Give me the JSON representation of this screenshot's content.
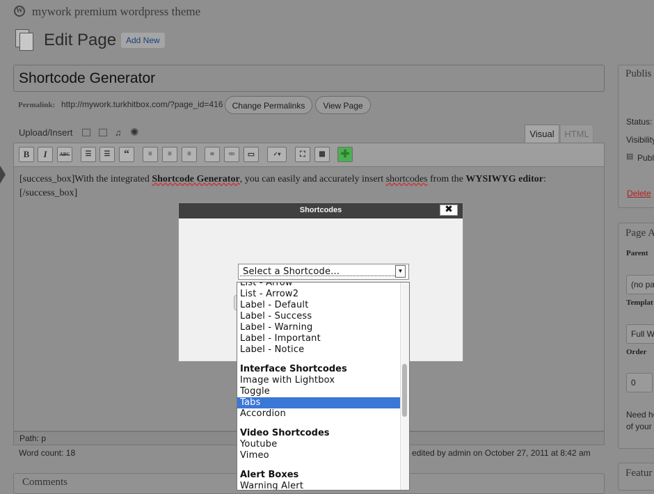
{
  "adminbar": {
    "site_title": "mywork premium wordpress theme",
    "logo_letter": "W"
  },
  "heading": {
    "title": "Edit Page",
    "add_new": "Add New"
  },
  "post": {
    "title": "Shortcode Generator",
    "permalink_label": "Permalink:",
    "permalink_url": "http://mywork.turkhitbox.com/?page_id=416",
    "change_permalinks": "Change Permalinks",
    "view_page": "View Page"
  },
  "editor": {
    "upload_insert": "Upload/Insert",
    "tab_visual": "Visual",
    "tab_html": "HTML",
    "content": {
      "pre": "[success_box]With the integrated ",
      "bold1": "Shortcode Generator",
      "mid": ", you can easily and accurately insert ",
      "link": "shortcodes",
      "mid2": " from the ",
      "bold2": "WYSIWYG editor",
      "post": ":",
      "line2": "[/success_box]"
    },
    "path": "Path: p",
    "word_count": "Word count: 18",
    "last_edited": "edited by admin on October 27, 2011 at 8:42 am",
    "toolbar": {
      "bold": "B",
      "italic": "I",
      "strike": "ABC",
      "quote": "“"
    }
  },
  "comments_box": {
    "title": "Comments"
  },
  "sidebar": {
    "publish_title": "Publis",
    "status": "Status:",
    "visibility": "Visibility",
    "publish_date": "Publi",
    "delete": "Delete",
    "page_attr_title": "Page A",
    "parent_label": "Parent",
    "parent_value": "(no pa",
    "template_label": "Templat",
    "template_value": "Full W",
    "order_label": "Order",
    "order_value": "0",
    "help_line1": "Need he",
    "help_line2": "of your",
    "featured_title": "Featur"
  },
  "modal": {
    "title": "Shortcodes",
    "close": "✖",
    "select_value": "Select a Shortcode...",
    "list": [
      {
        "type": "item",
        "label": "List - Arrow"
      },
      {
        "type": "item",
        "label": "List - Arrow2"
      },
      {
        "type": "item",
        "label": "Label - Default"
      },
      {
        "type": "item",
        "label": "Label - Success"
      },
      {
        "type": "item",
        "label": "Label - Warning"
      },
      {
        "type": "item",
        "label": "Label - Important"
      },
      {
        "type": "item",
        "label": "Label - Notice"
      },
      {
        "type": "group",
        "label": "Interface Shortcodes"
      },
      {
        "type": "item",
        "label": "Image with Lightbox"
      },
      {
        "type": "item",
        "label": "Toggle"
      },
      {
        "type": "item",
        "label": "Tabs",
        "selected": true
      },
      {
        "type": "item",
        "label": "Accordion"
      },
      {
        "type": "group",
        "label": "Video Shortcodes"
      },
      {
        "type": "item",
        "label": "Youtube"
      },
      {
        "type": "item",
        "label": "Vimeo"
      },
      {
        "type": "group",
        "label": "Alert Boxes"
      },
      {
        "type": "item",
        "label": "Warning Alert"
      }
    ]
  },
  "colors": {
    "selection": "#3a77d6",
    "overlay": "#8f8f8f",
    "modal_header": "#404040",
    "add_plugin": "#3a9a3a"
  }
}
